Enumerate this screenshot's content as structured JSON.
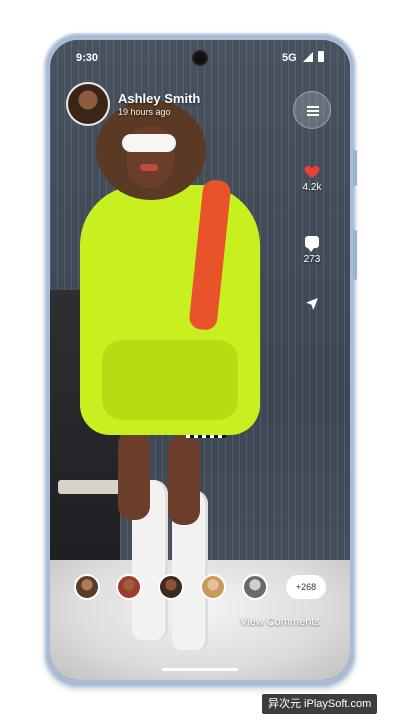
{
  "status_bar": {
    "time": "9:30",
    "network": "5G"
  },
  "post": {
    "user_name": "Ashley Smith",
    "time_ago": "19 hours ago"
  },
  "actions": {
    "likes": "4.2k",
    "comments": "273"
  },
  "viewers": {
    "more_count": "+268",
    "view_comments_label": "View Comments"
  },
  "watermark": "异次元 iPlaySoft.com",
  "colors": {
    "heart": "#e5413b",
    "hoodie": "#c8f01e",
    "phone_frame": "#a8bcd6"
  },
  "icons": [
    "menu-icon",
    "heart-icon",
    "comment-icon",
    "send-icon"
  ]
}
